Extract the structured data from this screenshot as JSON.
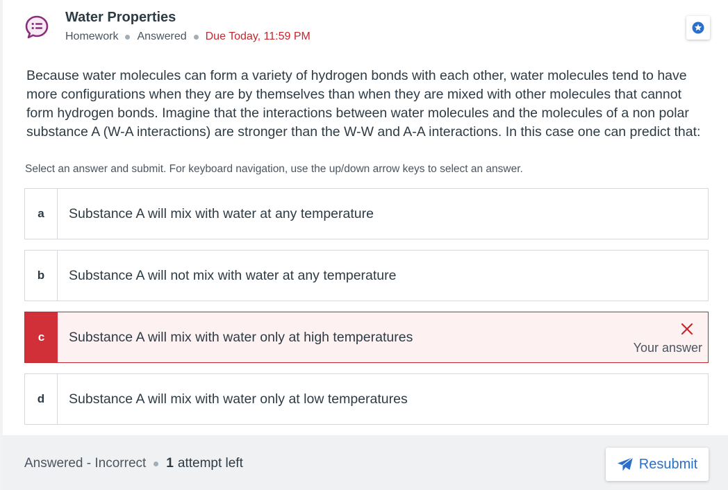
{
  "assignment": {
    "title": "Water Properties",
    "type": "Homework",
    "status": "Answered",
    "due": "Due Today, 11:59 PM",
    "icon": "question-bubble-icon",
    "bookmark_icon": "star-badge-icon"
  },
  "question": {
    "text": "Because water molecules can form a variety of hydrogen bonds with each other, water molecules tend to have more configurations when they are by themselves than when they are mixed with other molecules that cannot form hydrogen bonds. Imagine that the interactions between water molecules and the molecules of a non polar substance A (W-A interactions) are stronger than the W-W and A-A interactions. In this case one can predict that:",
    "instructions": "Select an answer and submit. For keyboard navigation, use the up/down arrow keys to select an answer."
  },
  "options": [
    {
      "letter": "a",
      "text": "Substance A will mix with water at any temperature"
    },
    {
      "letter": "b",
      "text": "Substance A will not mix with water at any temperature"
    },
    {
      "letter": "c",
      "text": "Substance A will mix with water only at high temperatures",
      "selected": true,
      "correct": false,
      "feedback": "Your answer"
    },
    {
      "letter": "d",
      "text": "Substance A will mix with water only at low temperatures"
    }
  ],
  "footer": {
    "status": "Answered - Incorrect",
    "attempts_count": "1",
    "attempts_label": "attempt left",
    "resubmit_label": "Resubmit",
    "resubmit_icon": "paper-plane-icon"
  },
  "colors": {
    "accent": "#2a6fc9",
    "icon_purple": "#8b2c7c",
    "error": "#c4272e",
    "error_bg": "#fdf1f1",
    "footer_bg": "#f0f1f2"
  }
}
